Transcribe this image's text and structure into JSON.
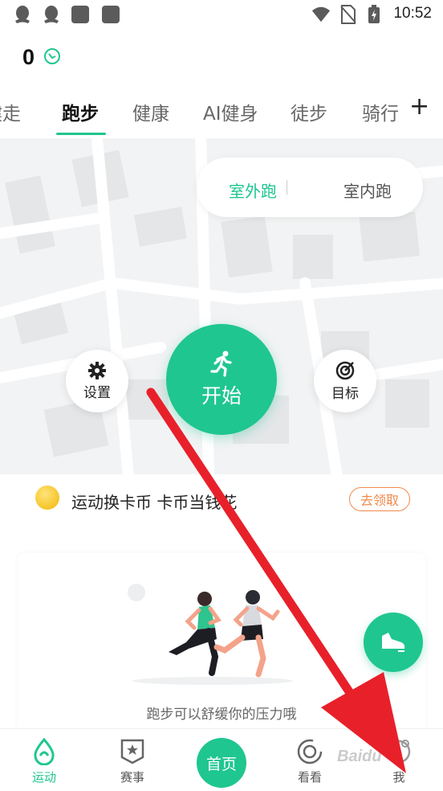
{
  "status_bar": {
    "time": "10:52"
  },
  "header": {
    "coin_count": "0"
  },
  "tabs": [
    {
      "label": "健走"
    },
    {
      "label": "跑步"
    },
    {
      "label": "健康"
    },
    {
      "label": "AI健身"
    },
    {
      "label": "徒步"
    },
    {
      "label": "骑行"
    }
  ],
  "mode_switch": {
    "outdoor": "室外跑",
    "indoor": "室内跑"
  },
  "controls": {
    "settings": "设置",
    "start": "开始",
    "goal": "目标"
  },
  "promo": {
    "text": "运动换卡币 卡币当钱花",
    "button": "去领取"
  },
  "illustration": {
    "caption": "跑步可以舒缓你的压力哦"
  },
  "bottom_nav": {
    "sport": "运动",
    "events": "赛事",
    "home": "首页",
    "watch": "看看",
    "me": "我"
  },
  "watermark": "Baidu",
  "colors": {
    "accent": "#1fc690",
    "promo_orange": "#f08a4b",
    "arrow": "#e8202a"
  }
}
